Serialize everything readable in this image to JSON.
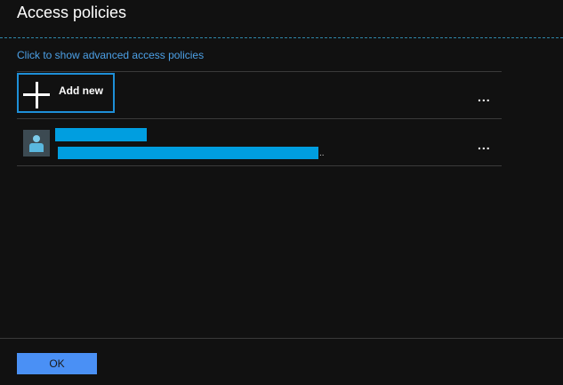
{
  "blade": {
    "title": "Access policies",
    "advanced_link": "Click to show advanced access policies"
  },
  "toolbar": {
    "add_new_label": "Add new",
    "more_label": "..."
  },
  "policies": [
    {
      "more_label": "...",
      "truncation": ".."
    }
  ],
  "footer": {
    "ok_label": "OK"
  },
  "colors": {
    "background": "#111111",
    "accent": "#1e8fd8",
    "link": "#4ca0e6",
    "ok_button": "#4a90f5",
    "redaction": "#009ee0"
  }
}
